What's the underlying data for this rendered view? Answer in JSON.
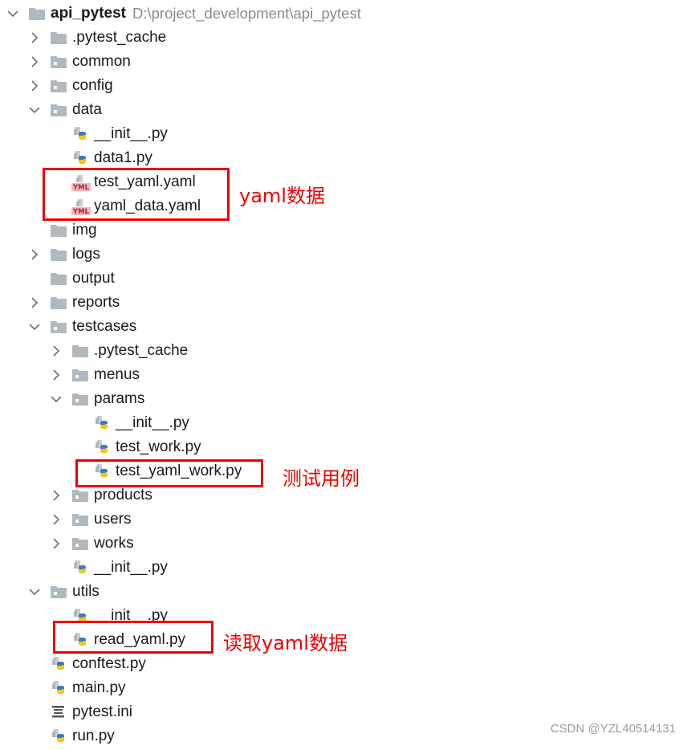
{
  "tree": {
    "root": {
      "name": "api_pytest",
      "path": "D:\\project_development\\api_pytest"
    },
    "items": [
      {
        "name": ".pytest_cache",
        "type": "folder-plain",
        "expanded": false
      },
      {
        "name": "common",
        "type": "folder-package",
        "expanded": false
      },
      {
        "name": "config",
        "type": "folder-package",
        "expanded": false
      },
      {
        "name": "data",
        "type": "folder-package",
        "expanded": true
      },
      {
        "name": "__init__.py",
        "type": "python-file"
      },
      {
        "name": "data1.py",
        "type": "python-file"
      },
      {
        "name": "test_yaml.yaml",
        "type": "yaml-file"
      },
      {
        "name": "yaml_data.yaml",
        "type": "yaml-file"
      },
      {
        "name": "img",
        "type": "folder-plain"
      },
      {
        "name": "logs",
        "type": "folder-plain",
        "expanded": false
      },
      {
        "name": "output",
        "type": "folder-plain"
      },
      {
        "name": "reports",
        "type": "folder-plain",
        "expanded": false
      },
      {
        "name": "testcases",
        "type": "folder-package",
        "expanded": true
      },
      {
        "name": ".pytest_cache",
        "type": "folder-plain",
        "expanded": false
      },
      {
        "name": "menus",
        "type": "folder-package",
        "expanded": false
      },
      {
        "name": "params",
        "type": "folder-package",
        "expanded": true
      },
      {
        "name": "__init__.py",
        "type": "python-file"
      },
      {
        "name": "test_work.py",
        "type": "python-file"
      },
      {
        "name": "test_yaml_work.py",
        "type": "python-file"
      },
      {
        "name": "products",
        "type": "folder-package",
        "expanded": false
      },
      {
        "name": "users",
        "type": "folder-package",
        "expanded": false
      },
      {
        "name": "works",
        "type": "folder-package",
        "expanded": false
      },
      {
        "name": "__init__.py",
        "type": "python-file"
      },
      {
        "name": "utils",
        "type": "folder-package",
        "expanded": true
      },
      {
        "name": "__init__.py",
        "type": "python-file"
      },
      {
        "name": "read_yaml.py",
        "type": "python-file"
      },
      {
        "name": "conftest.py",
        "type": "python-file"
      },
      {
        "name": "main.py",
        "type": "python-file"
      },
      {
        "name": "pytest.ini",
        "type": "ini-file"
      },
      {
        "name": "run.py",
        "type": "python-file"
      }
    ]
  },
  "annotations": {
    "yaml_data": "yaml数据",
    "test_case": "测试用例",
    "read_yaml": "读取yaml数据"
  },
  "colors": {
    "annotation": "#ee0000",
    "folder": "#aeb9c0",
    "text": "#1a1a1a",
    "path": "#8a8a8a"
  },
  "watermark": "CSDN @YZL40514131"
}
